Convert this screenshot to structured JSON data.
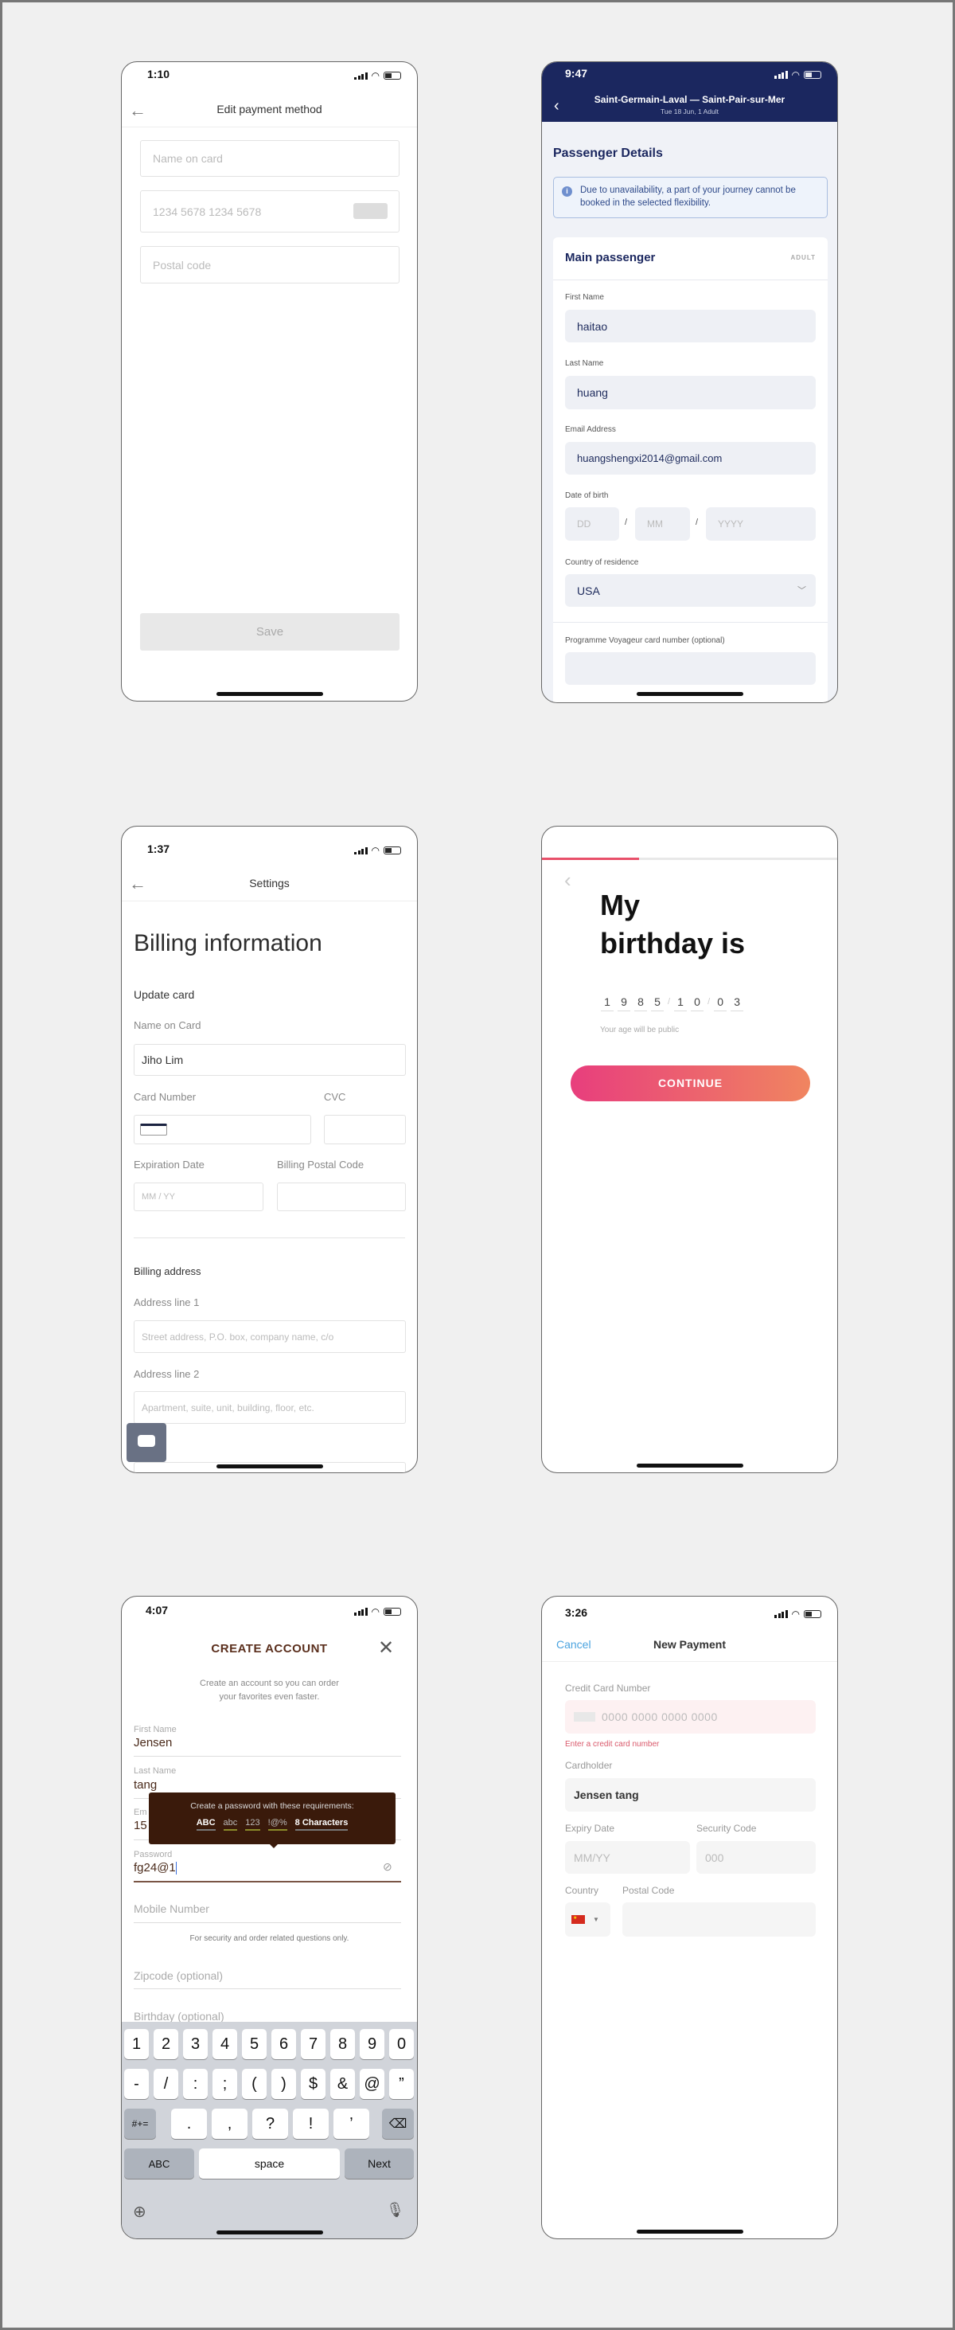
{
  "screens": {
    "edit_payment": {
      "time": "1:10",
      "title": "Edit payment method",
      "name_placeholder": "Name on card",
      "card_placeholder": "1234 5678 1234 5678",
      "postal_placeholder": "Postal code",
      "save_label": "Save"
    },
    "passenger": {
      "time": "9:47",
      "route": "Saint-Germain-Laval — Saint-Pair-sur-Mer",
      "subtitle": "Tue 18 Jun, 1 Adult",
      "heading": "Passenger Details",
      "notice": "Due to unavailability, a part of your journey cannot be booked in the selected flexibility.",
      "card_title": "Main passenger",
      "badge": "ADULT",
      "first_name_label": "First Name",
      "first_name": "haitao",
      "last_name_label": "Last Name",
      "last_name": "huang",
      "email_label": "Email Address",
      "email": "huangshengxi2014@gmail.com",
      "dob_label": "Date of birth",
      "dd": "DD",
      "mm": "MM",
      "yyyy": "YYYY",
      "sep": "/",
      "country_label": "Country of residence",
      "country": "USA",
      "voyageur_label": "Programme Voyageur card number (optional)",
      "brand_color": "#1b275f"
    },
    "billing": {
      "time": "1:37",
      "header": "Settings",
      "title": "Billing information",
      "update_card": "Update card",
      "name_label": "Name on Card",
      "name_value": "Jiho Lim",
      "card_number_label": "Card Number",
      "cvc_label": "CVC",
      "exp_label": "Expiration Date",
      "exp_placeholder": "MM / YY",
      "postal_label": "Billing Postal Code",
      "billing_address": "Billing address",
      "addr1_label": "Address line 1",
      "addr1_placeholder": "Street address, P.O. box, company name, c/o",
      "addr2_label": "Address line 2",
      "addr2_placeholder": "Apartment, suite, unit, building, floor, etc."
    },
    "birthday": {
      "progress_percent": 33,
      "title_line1": "My",
      "title_line2": "birthday is",
      "digits": [
        "1",
        "9",
        "8",
        "5",
        "1",
        "0",
        "0",
        "3"
      ],
      "sep": "/",
      "hint": "Your age will be public",
      "continue_label": "CONTINUE",
      "gradient_start": "#e83e7d",
      "gradient_end": "#f08560"
    },
    "create_account": {
      "time": "4:07",
      "title": "CREATE ACCOUNT",
      "subtitle_line1": "Create an account so you can order",
      "subtitle_line2": "your favorites even faster.",
      "first_name_label": "First Name",
      "first_name": "Jensen",
      "last_name_label": "Last Name",
      "last_name": "tang",
      "email_label": "Em",
      "email_value": "15",
      "tooltip_title": "Create a password with these requirements:",
      "requirements": [
        "ABC",
        "abc",
        "123",
        "!@%",
        "8 Characters"
      ],
      "password_label": "Password",
      "password_value": "fg24@1",
      "mobile_placeholder": "Mobile Number",
      "mobile_note": "For security and order related questions only.",
      "zip_placeholder": "Zipcode (optional)",
      "birthday_placeholder": "Birthday (optional)",
      "keyboard": {
        "row1": [
          "1",
          "2",
          "3",
          "4",
          "5",
          "6",
          "7",
          "8",
          "9",
          "0"
        ],
        "row2": [
          "-",
          "/",
          ":",
          ";",
          "(",
          ")",
          "$",
          "&",
          "@",
          "”"
        ],
        "row3": [
          ".",
          ",",
          "?",
          "!",
          "’"
        ],
        "shift": "#+=",
        "abc": "ABC",
        "space": "space",
        "next": "Next"
      }
    },
    "new_payment": {
      "time": "3:26",
      "cancel": "Cancel",
      "title": "New Payment",
      "cc_label": "Credit Card Number",
      "cc_placeholder": "0000 0000 0000 0000",
      "cc_error": "Enter a credit card number",
      "holder_label": "Cardholder",
      "holder_value": "Jensen tang",
      "expiry_label": "Expiry Date",
      "expiry_placeholder": "MM/YY",
      "security_label": "Security Code",
      "security_placeholder": "000",
      "country_label": "Country",
      "postal_label": "Postal Code",
      "accent_color": "#4aa3df",
      "error_color": "#d9596b"
    }
  }
}
